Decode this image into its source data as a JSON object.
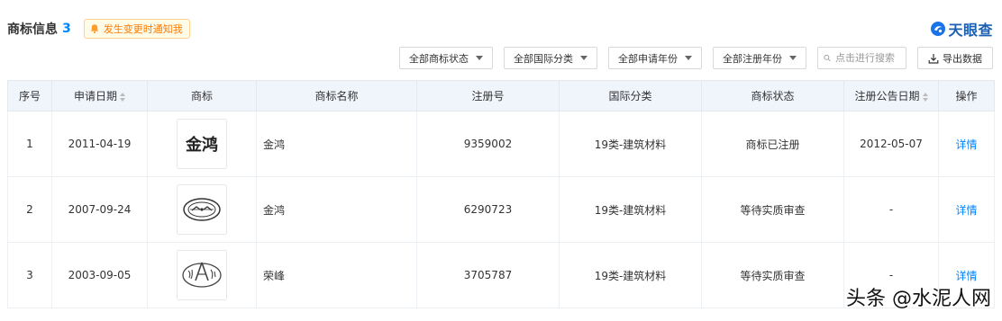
{
  "header": {
    "title": "商标信息",
    "count": "3",
    "notify_label": "发生变更时通知我"
  },
  "brand": {
    "name": "天眼查"
  },
  "toolbar": {
    "filters": [
      "全部商标状态",
      "全部国际分类",
      "全部申请年份",
      "全部注册年份"
    ],
    "search_placeholder": "点击进行搜索",
    "export_label": "导出数据"
  },
  "table": {
    "headers": [
      "序号",
      "申请日期",
      "商标",
      "商标名称",
      "注册号",
      "国际分类",
      "商标状态",
      "注册公告日期",
      "操作"
    ],
    "rows": [
      {
        "index": "1",
        "apply_date": "2011-04-19",
        "logo_text": "金鸿",
        "name": "金鸿",
        "reg_no": "9359002",
        "category": "19类-建筑材料",
        "status": "商标已注册",
        "pub_date": "2012-05-07",
        "action": "详情"
      },
      {
        "index": "2",
        "apply_date": "2007-09-24",
        "logo_text": "",
        "name": "金鸿",
        "reg_no": "6290723",
        "category": "19类-建筑材料",
        "status": "等待实质审查",
        "pub_date": "-",
        "action": "详情"
      },
      {
        "index": "3",
        "apply_date": "2003-09-05",
        "logo_text": "",
        "name": "荣峰",
        "reg_no": "3705787",
        "category": "19类-建筑材料",
        "status": "等待实质审查",
        "pub_date": "-",
        "action": "详情"
      }
    ]
  },
  "watermark": "头条 @水泥人网",
  "colors": {
    "accent": "#0084ff",
    "header_bg": "#f0f5fc",
    "notify_text": "#ff7a00",
    "brand": "#1a5fb4"
  },
  "icons": [
    "bell-icon",
    "tianyancha-logo-icon",
    "caret-down-icon",
    "search-icon",
    "export-icon",
    "sort-icon"
  ]
}
